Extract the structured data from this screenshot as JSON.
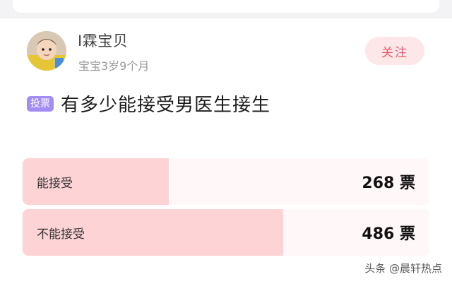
{
  "user": {
    "name": "I霖宝贝",
    "subtitle": "宝宝3岁9个月",
    "follow_label": "关注"
  },
  "poll": {
    "badge": "投票",
    "title": "有多少能接受男医生接生",
    "options": [
      {
        "label": "能接受",
        "votes": "268 票",
        "fraction": 0.36
      },
      {
        "label": "不能接受",
        "votes": "486 票",
        "fraction": 0.64
      }
    ]
  },
  "watermark": "头条 @晨轩热点",
  "colors": {
    "badge": "#a58cf3",
    "follow_bg": "#fde7e9",
    "follow_text": "#e85a6a",
    "bar_fill": "#fdd3d6",
    "bar_bg": "#fff7f8"
  }
}
